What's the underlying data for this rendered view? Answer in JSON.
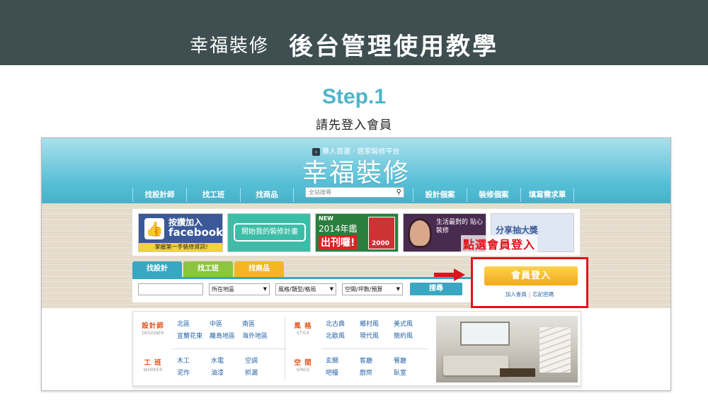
{
  "tutorial": {
    "brand": "幸福裝修",
    "title": "後台管理使用教學",
    "step": "Step.1",
    "instruction": "請先登入會員"
  },
  "site": {
    "tagline": "華人首選 · 居家裝修平台",
    "logo": "幸福裝修",
    "nav_left": [
      "找設計師",
      "找工班",
      "找商品"
    ],
    "nav_right": [
      "設計個案",
      "裝修個案",
      "填寫需求單"
    ],
    "search_placeholder": "全站搜尋",
    "banners": {
      "facebook_line1": "按讚加入",
      "facebook_line2": "facebook",
      "facebook_sub": "掌握第一手裝修資訊!",
      "plan": "開始我的裝修計畫",
      "mag_new": "NEW",
      "mag_year": "2014年鑑",
      "mag_out": "出刊囉!",
      "mag_num": "2000",
      "life_text": "生活最對的 貼心裝修",
      "share": "分享抽大獎"
    },
    "callout": "點選會員登入",
    "search_tabs": [
      "找設計",
      "找工班",
      "找商品"
    ],
    "selects": [
      "所在地區",
      "風格/類型/格局",
      "空間/坪數/預算"
    ],
    "search_button": "搜尋",
    "login_button": "會員登入",
    "login_links": [
      "加入會員",
      "忘記密碼"
    ],
    "directory": {
      "designer": {
        "cn": "設計師",
        "en": "DESIGNER",
        "items": [
          "北區",
          "中區",
          "南區",
          "宜蘭花東",
          "離島地區",
          "海外地區"
        ]
      },
      "worker": {
        "cn": "工 班",
        "en": "WORKER",
        "items": [
          "木工",
          "水電",
          "空調",
          "泥作",
          "油漆",
          "抓漏"
        ]
      },
      "style": {
        "cn": "風 格",
        "en": "STYLE",
        "items": [
          "北古典",
          "鄉村風",
          "美式風",
          "北歐風",
          "現代風",
          "簡約風"
        ]
      },
      "space": {
        "cn": "空 間",
        "en": "SPACE",
        "items": [
          "玄關",
          "客廳",
          "餐廳",
          "吧檯",
          "廚房",
          "臥室"
        ]
      }
    }
  },
  "colors": {
    "header_bg": "#3f4f51",
    "step_color": "#4fb4ca",
    "site_blue": "#45b2ca",
    "highlight_red": "#e0141a",
    "login_orange": "#f2a91b"
  }
}
